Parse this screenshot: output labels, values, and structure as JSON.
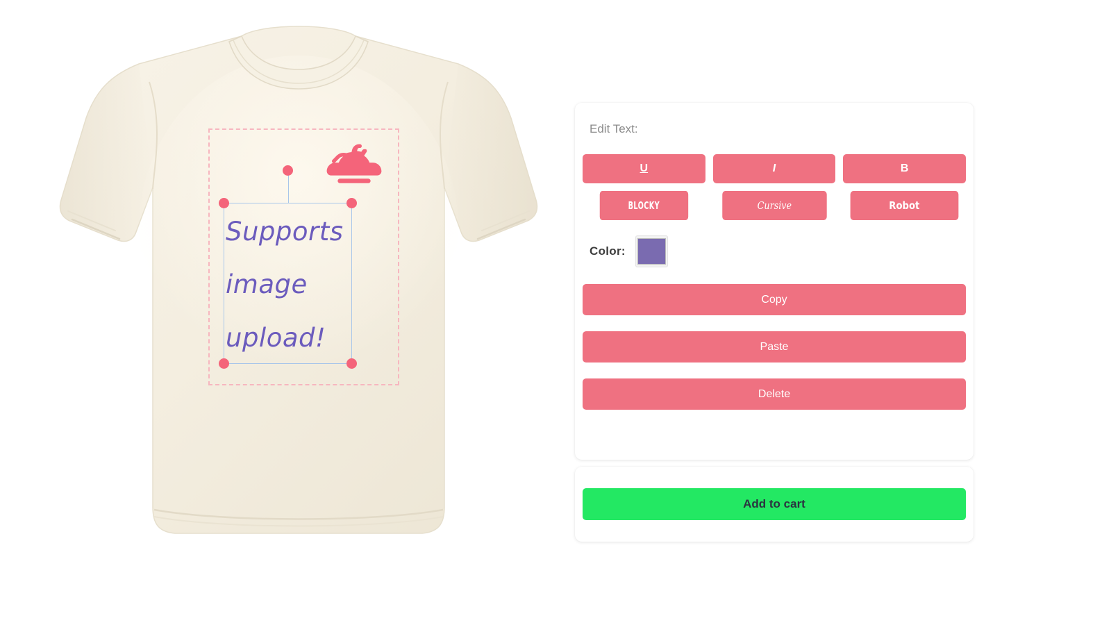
{
  "product": {
    "type": "t-shirt-mockup",
    "shirt_color": "#f5efe2",
    "shirt_color_name": "cream",
    "print_area_border_color": "#f7b6bf"
  },
  "design": {
    "selected_object": "text",
    "text_lines": [
      "Supports",
      "image",
      "upload!"
    ],
    "text_color": "#6b5bbd",
    "text_style": "cursive-italic",
    "selection_border_color": "#a8c6ea",
    "handle_color": "#f4647a",
    "image_icon": {
      "name": "magic-lamp-icon",
      "color": "#f4647a"
    }
  },
  "editor": {
    "title": "Edit Text:",
    "format_buttons": [
      {
        "id": "underline",
        "label": "U"
      },
      {
        "id": "italic",
        "label": "I"
      },
      {
        "id": "bold",
        "label": "B"
      }
    ],
    "font_buttons": [
      {
        "id": "blocky",
        "label": "BLOCKY"
      },
      {
        "id": "cursive",
        "label": "Cursive"
      },
      {
        "id": "robot",
        "label": "Robot"
      }
    ],
    "color": {
      "label": "Color:",
      "value": "#7a6bb0"
    },
    "actions": [
      {
        "id": "copy",
        "label": "Copy"
      },
      {
        "id": "paste",
        "label": "Paste"
      },
      {
        "id": "delete",
        "label": "Delete"
      }
    ],
    "button_color": "#ef7181"
  },
  "cart": {
    "add_label": "Add to cart",
    "add_color": "#23e863"
  }
}
